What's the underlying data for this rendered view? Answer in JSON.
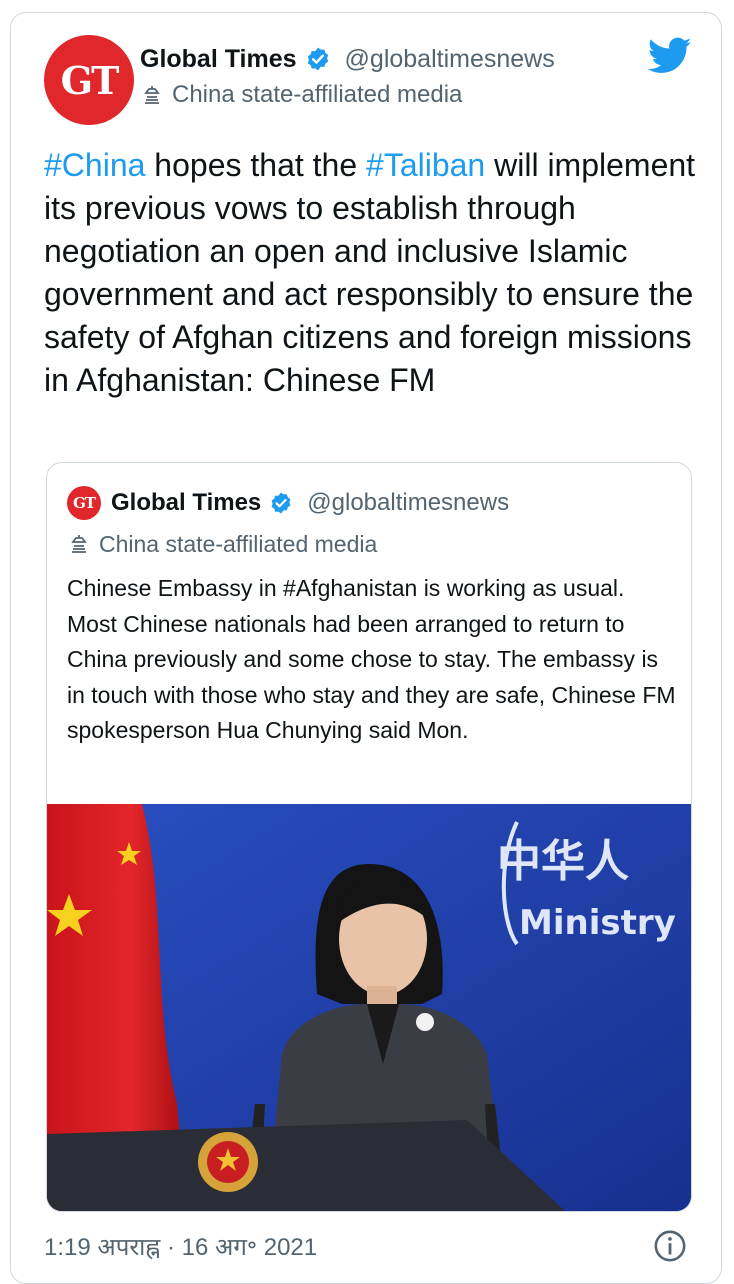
{
  "tweet": {
    "author": {
      "avatar_text": "GT",
      "display_name": "Global Times",
      "handle": "@globaltimesnews",
      "affiliation": "China state-affiliated media"
    },
    "text_segments": [
      {
        "text": "#China",
        "hashtag": true
      },
      {
        "text": " hopes that the ",
        "hashtag": false
      },
      {
        "text": "#Taliban",
        "hashtag": true
      },
      {
        "text": " will implement its previous vows to establish through negotiation an open and inclusive Islamic government and act responsibly to ensure the safety of Afghan citizens and foreign missions in Afghanistan: Chinese FM",
        "hashtag": false
      }
    ],
    "timestamp": "1:19 अपराह्न · 16 अग॰ 2021"
  },
  "quoted_tweet": {
    "author": {
      "avatar_text": "GT",
      "display_name": "Global Times",
      "handle": "@globaltimesnews",
      "affiliation": "China state-affiliated media"
    },
    "text": "Chinese Embassy in #Afghanistan is working as usual. Most Chinese nationals had been arranged to return to China previously and some chose to stay. The embassy is in touch with those who stay and they are safe, Chinese FM spokesperson Hua Chunying said Mon.",
    "image": {
      "backdrop_text_cn": "中华人",
      "backdrop_text_en": "Ministry"
    }
  },
  "colors": {
    "link": "#1d9bf0",
    "secondary_text": "#536471",
    "avatar_red": "#e0272b",
    "backdrop_blue": "#1f3ea8"
  },
  "icons": [
    "verified-badge-icon",
    "state-media-flag-icon",
    "twitter-bird-icon",
    "info-icon"
  ]
}
